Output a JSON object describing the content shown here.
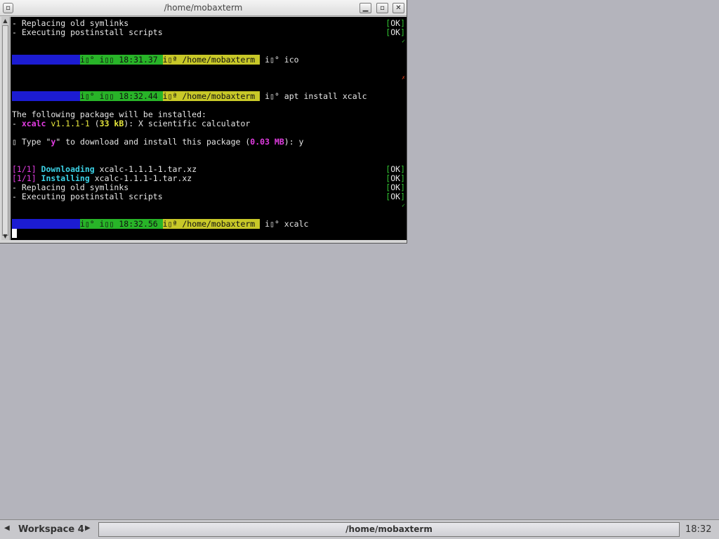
{
  "window": {
    "title": "/home/mobaxterm",
    "menu_icon": "window-menu-icon",
    "min_icon": "minimize-icon",
    "max_icon": "maximize-icon",
    "close_icon": "close-icon"
  },
  "terminal": {
    "line1": "- Replacing old symlinks",
    "line2": "- Executing postinstall scripts",
    "ok_open": "[",
    "ok_text": "OK",
    "ok_close": "]",
    "prompt_segment": "i▯° i▯▯ ",
    "prompt_path_icon": "i▯ª ",
    "prompt_path": "/home/mobaxterm",
    "prompt_arrow": " i▯°",
    "prompt1": {
      "user": "          ",
      "time": "18:31.37",
      "cmd": " ico"
    },
    "prompt2": {
      "user": "          ",
      "time": "18:32.44",
      "cmd": " apt install xcalc"
    },
    "following": "The following package will be installed:",
    "pkg_dash": "- ",
    "pkg_name": "xcalc",
    "pkg_ver": " v1.1.1-1",
    "pkg_size_open": " (",
    "pkg_size": "33 kB",
    "pkg_desc": "): X scientific calculator",
    "ask_prefix": "▯ T",
    "ask_cursor": "ype \"",
    "ask_y": "y",
    "ask_mid": "\" to download and install this package (",
    "ask_size": "0.03 MB",
    "ask_end": "): y",
    "dl_tag": "[1/1]",
    "dl_word": " Downloading",
    "dl_file": " xcalc-1.1.1-1.tar.xz",
    "in_word": " Installing",
    "in_file": " xcalc-1.1.1-1.tar.xz",
    "prompt3": {
      "user": "          ",
      "time": "18:32.56",
      "cmd": " xcalc"
    }
  },
  "taskbar": {
    "workspace_label": "Workspace 4",
    "prev_icon": "◀",
    "next_icon": "▶",
    "task_title": "/home/mobaxterm",
    "clock": "18:32"
  }
}
